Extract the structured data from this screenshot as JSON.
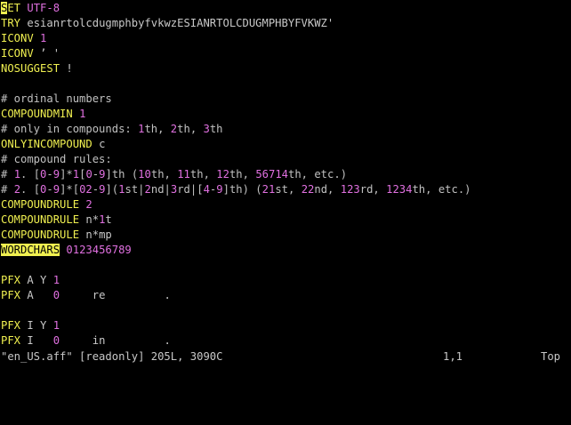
{
  "editor": {
    "lines": [
      {
        "segs": [
          {
            "t": "S",
            "c": "cursor"
          },
          {
            "t": "ET",
            "c": "kw"
          },
          {
            "t": " ",
            "c": "txt"
          },
          {
            "t": "UTF-8",
            "c": "num"
          }
        ]
      },
      {
        "segs": [
          {
            "t": "TRY",
            "c": "kw"
          },
          {
            "t": " esianrtolcdugmphbyfvkwzESIANRTOLCDUGMPHBYFVKWZ'",
            "c": "txt"
          }
        ]
      },
      {
        "segs": [
          {
            "t": "ICONV",
            "c": "kw"
          },
          {
            "t": " ",
            "c": "txt"
          },
          {
            "t": "1",
            "c": "num"
          }
        ]
      },
      {
        "segs": [
          {
            "t": "ICONV",
            "c": "kw"
          },
          {
            "t": " ’ '",
            "c": "txt"
          }
        ]
      },
      {
        "segs": [
          {
            "t": "NOSUGGEST",
            "c": "kw"
          },
          {
            "t": " !",
            "c": "txt"
          }
        ]
      },
      {
        "segs": []
      },
      {
        "segs": [
          {
            "t": "# ordinal numbers",
            "c": "com"
          }
        ]
      },
      {
        "segs": [
          {
            "t": "COMPOUNDMIN",
            "c": "kw"
          },
          {
            "t": " ",
            "c": "txt"
          },
          {
            "t": "1",
            "c": "num"
          }
        ]
      },
      {
        "segs": [
          {
            "t": "# only in compounds: ",
            "c": "com"
          },
          {
            "t": "1",
            "c": "num"
          },
          {
            "t": "th, ",
            "c": "com"
          },
          {
            "t": "2",
            "c": "num"
          },
          {
            "t": "th, ",
            "c": "com"
          },
          {
            "t": "3",
            "c": "num"
          },
          {
            "t": "th",
            "c": "com"
          }
        ]
      },
      {
        "segs": [
          {
            "t": "ONLYINCOMPOUND",
            "c": "kw"
          },
          {
            "t": " c",
            "c": "txt"
          }
        ]
      },
      {
        "segs": [
          {
            "t": "# compound rules:",
            "c": "com"
          }
        ]
      },
      {
        "segs": [
          {
            "t": "# ",
            "c": "com"
          },
          {
            "t": "1",
            "c": "num"
          },
          {
            "t": ". [",
            "c": "com"
          },
          {
            "t": "0",
            "c": "num"
          },
          {
            "t": "-",
            "c": "com"
          },
          {
            "t": "9",
            "c": "num"
          },
          {
            "t": "]*",
            "c": "com"
          },
          {
            "t": "1",
            "c": "num"
          },
          {
            "t": "[",
            "c": "com"
          },
          {
            "t": "0",
            "c": "num"
          },
          {
            "t": "-",
            "c": "com"
          },
          {
            "t": "9",
            "c": "num"
          },
          {
            "t": "]th (",
            "c": "com"
          },
          {
            "t": "10",
            "c": "num"
          },
          {
            "t": "th, ",
            "c": "com"
          },
          {
            "t": "11",
            "c": "num"
          },
          {
            "t": "th, ",
            "c": "com"
          },
          {
            "t": "12",
            "c": "num"
          },
          {
            "t": "th, ",
            "c": "com"
          },
          {
            "t": "56714",
            "c": "num"
          },
          {
            "t": "th, etc.)",
            "c": "com"
          }
        ]
      },
      {
        "segs": [
          {
            "t": "# ",
            "c": "com"
          },
          {
            "t": "2",
            "c": "num"
          },
          {
            "t": ". [",
            "c": "com"
          },
          {
            "t": "0",
            "c": "num"
          },
          {
            "t": "-",
            "c": "com"
          },
          {
            "t": "9",
            "c": "num"
          },
          {
            "t": "]*[",
            "c": "com"
          },
          {
            "t": "02",
            "c": "num"
          },
          {
            "t": "-",
            "c": "com"
          },
          {
            "t": "9",
            "c": "num"
          },
          {
            "t": "](",
            "c": "com"
          },
          {
            "t": "1",
            "c": "num"
          },
          {
            "t": "st|",
            "c": "com"
          },
          {
            "t": "2",
            "c": "num"
          },
          {
            "t": "nd|",
            "c": "com"
          },
          {
            "t": "3",
            "c": "num"
          },
          {
            "t": "rd|[",
            "c": "com"
          },
          {
            "t": "4",
            "c": "num"
          },
          {
            "t": "-",
            "c": "com"
          },
          {
            "t": "9",
            "c": "num"
          },
          {
            "t": "]th) (",
            "c": "com"
          },
          {
            "t": "21",
            "c": "num"
          },
          {
            "t": "st, ",
            "c": "com"
          },
          {
            "t": "22",
            "c": "num"
          },
          {
            "t": "nd, ",
            "c": "com"
          },
          {
            "t": "123",
            "c": "num"
          },
          {
            "t": "rd, ",
            "c": "com"
          },
          {
            "t": "1234",
            "c": "num"
          },
          {
            "t": "th, etc.)",
            "c": "com"
          }
        ]
      },
      {
        "segs": [
          {
            "t": "COMPOUNDRULE",
            "c": "kw"
          },
          {
            "t": " ",
            "c": "txt"
          },
          {
            "t": "2",
            "c": "num"
          }
        ]
      },
      {
        "segs": [
          {
            "t": "COMPOUNDRULE",
            "c": "kw"
          },
          {
            "t": " n*",
            "c": "txt"
          },
          {
            "t": "1",
            "c": "num"
          },
          {
            "t": "t",
            "c": "txt"
          }
        ]
      },
      {
        "segs": [
          {
            "t": "COMPOUNDRULE",
            "c": "kw"
          },
          {
            "t": " n*mp",
            "c": "txt"
          }
        ]
      },
      {
        "segs": [
          {
            "t": "WORDCHARS",
            "c": "hl"
          },
          {
            "t": " ",
            "c": "txt"
          },
          {
            "t": "0123456789",
            "c": "num"
          }
        ]
      },
      {
        "segs": []
      },
      {
        "segs": [
          {
            "t": "PFX",
            "c": "kw"
          },
          {
            "t": " A Y ",
            "c": "txt"
          },
          {
            "t": "1",
            "c": "num"
          }
        ]
      },
      {
        "segs": [
          {
            "t": "PFX",
            "c": "kw"
          },
          {
            "t": " A   ",
            "c": "txt"
          },
          {
            "t": "0",
            "c": "num"
          },
          {
            "t": "     re         .",
            "c": "txt"
          }
        ]
      },
      {
        "segs": []
      },
      {
        "segs": [
          {
            "t": "PFX",
            "c": "kw"
          },
          {
            "t": " I Y ",
            "c": "txt"
          },
          {
            "t": "1",
            "c": "num"
          }
        ]
      },
      {
        "segs": [
          {
            "t": "PFX",
            "c": "kw"
          },
          {
            "t": " I   ",
            "c": "txt"
          },
          {
            "t": "0",
            "c": "num"
          },
          {
            "t": "     in         .",
            "c": "txt"
          }
        ]
      }
    ]
  },
  "status": {
    "file": "\"en_US.aff\" [readonly] 205L, 3090C",
    "position": "1,1",
    "scroll": "Top"
  }
}
